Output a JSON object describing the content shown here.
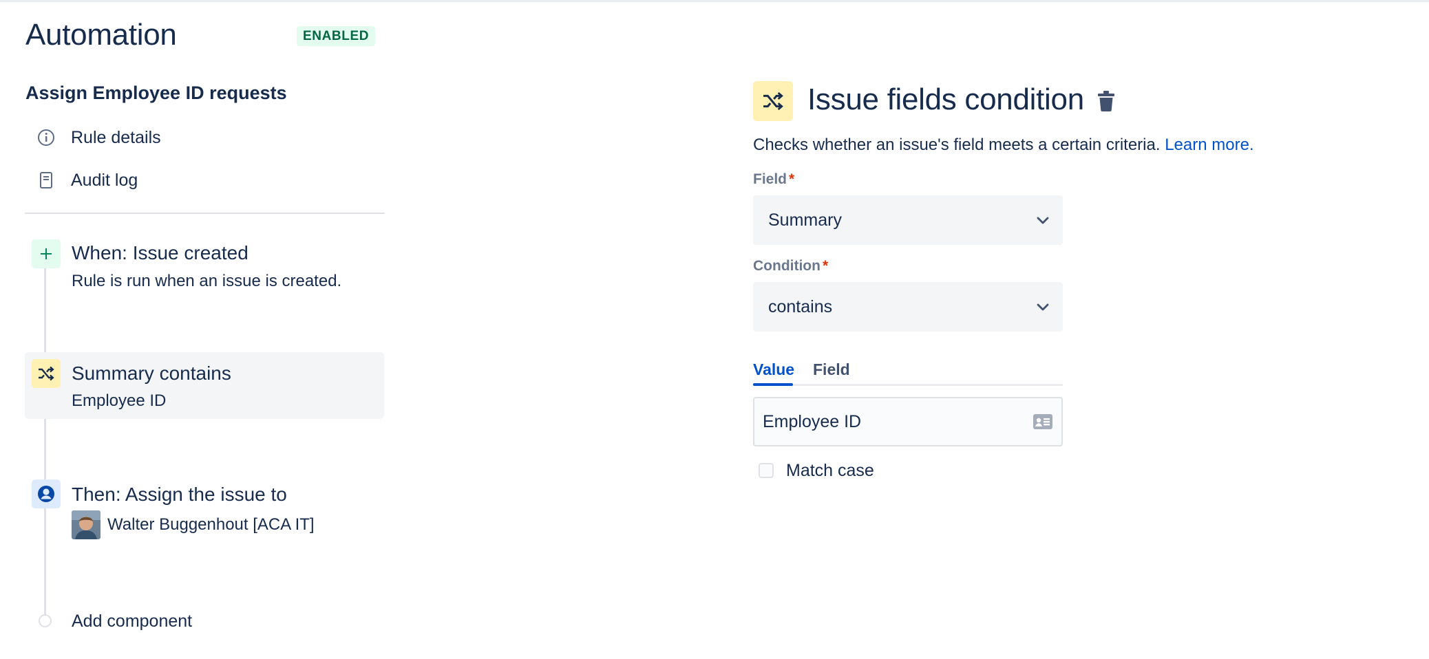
{
  "header": {
    "title": "Automation",
    "status": "ENABLED"
  },
  "rule": {
    "name": "Assign Employee ID requests",
    "nav": [
      {
        "label": "Rule details",
        "icon": "info-icon"
      },
      {
        "label": "Audit log",
        "icon": "audit-log-icon"
      }
    ],
    "components": {
      "trigger": {
        "title": "When: Issue created",
        "subtitle": "Rule is run when an issue is created.",
        "icon": "plus-icon"
      },
      "condition": {
        "title": "Summary contains",
        "subtitle": "Employee ID",
        "icon": "shuffle-icon"
      },
      "action": {
        "title": "Then: Assign the issue to",
        "assignee": "Walter Buggenhout [ACA IT]",
        "icon": "user-circle-icon"
      }
    },
    "add_component_label": "Add component"
  },
  "detail": {
    "title": "Issue fields condition",
    "description": "Checks whether an issue's field meets a certain criteria.",
    "learn_more": "Learn more.",
    "field_label": "Field",
    "field_value": "Summary",
    "condition_label": "Condition",
    "condition_value": "contains",
    "tabs": [
      "Value",
      "Field"
    ],
    "active_tab": "Value",
    "value_input": "Employee ID",
    "match_case_label": "Match case",
    "match_case_checked": false
  },
  "colors": {
    "accent": "#0052cc",
    "enabled_bg": "#e3fcef",
    "enabled_text": "#006644",
    "condition_icon_bg": "#fff0b3",
    "required": "#de350b"
  }
}
